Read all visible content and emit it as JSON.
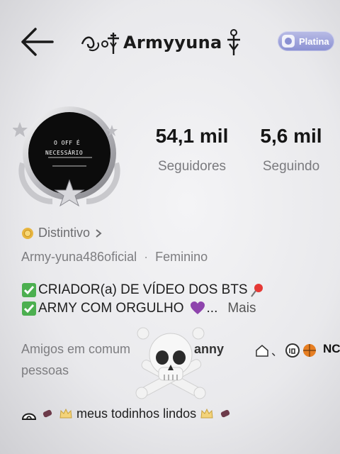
{
  "header": {
    "title": "Armyyuna",
    "badge_label": "Platina"
  },
  "avatar": {
    "line1": "O OFF É",
    "line2": "NECESSÁRIO"
  },
  "stats": {
    "followers_value": "54,1 mil",
    "followers_label": "Seguidores",
    "following_value": "5,6 mil",
    "following_label": "Seguindo"
  },
  "profile": {
    "badge_link": "Distintivo",
    "username": "Army-yuna486oficial",
    "separator": "·",
    "gender": "Feminino"
  },
  "bio": {
    "line1": "CRIADOR(a) DE VÍDEO DOS BTS",
    "line2": "ARMY COM ORGULHO",
    "ellipsis": "...",
    "more": "Mais"
  },
  "friends": {
    "label": "Amigos em comum",
    "name": "anny",
    "mid": "、",
    "tail": "NC",
    "count_label": "pessoas"
  },
  "pinned": {
    "text": "meus todinhos lindos"
  },
  "colors": {
    "badge": "#9aa0dc",
    "avatar_bg": "#0c0c0c",
    "stat_label": "#7a7a7e"
  }
}
